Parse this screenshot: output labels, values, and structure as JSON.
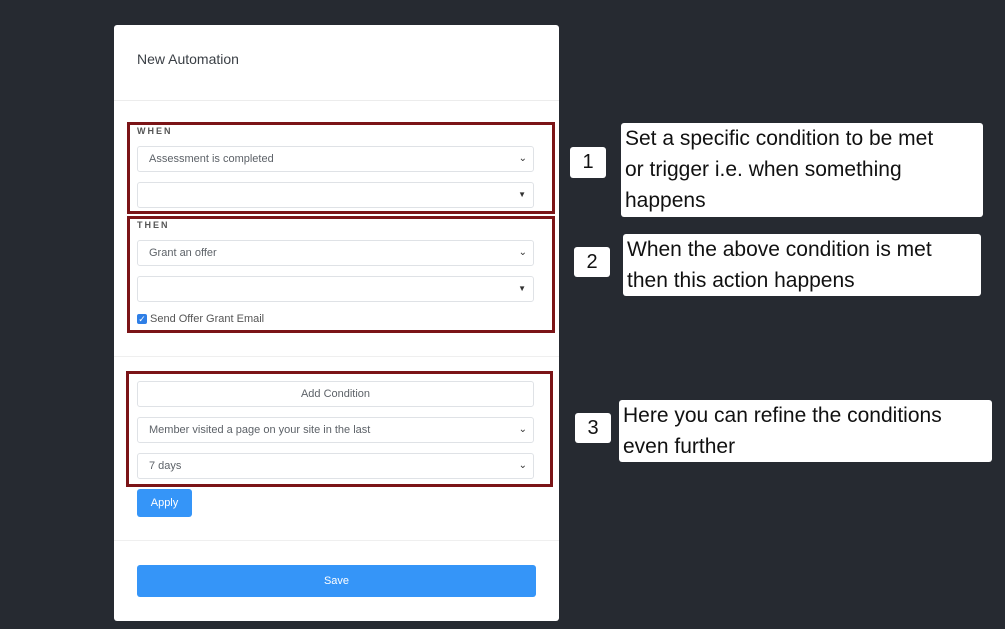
{
  "card": {
    "title": "New Automation",
    "when": {
      "label": "WHEN",
      "trigger_value": "Assessment is completed",
      "secondary_value": ""
    },
    "then": {
      "label": "THEN",
      "action_value": "Grant an offer",
      "secondary_value": "",
      "send_email_label": "Send Offer Grant Email",
      "send_email_checked": true
    },
    "conditions": {
      "add_condition_label": "Add Condition",
      "condition_value": "Member visited a page on your site in the last",
      "period_value": "7 days",
      "apply_label": "Apply"
    },
    "save_label": "Save"
  },
  "annotations": [
    {
      "number": "1",
      "text": "Set a specific condition to be met\n or trigger i.e. when something\nhappens"
    },
    {
      "number": "2",
      "text": "When the above condition is met\nthen this action happens"
    },
    {
      "number": "3",
      "text": "Here you can refine the conditions\neven further"
    }
  ],
  "colors": {
    "background": "#262a31",
    "primary": "#3595f8",
    "highlight_frame": "#7b1417"
  }
}
